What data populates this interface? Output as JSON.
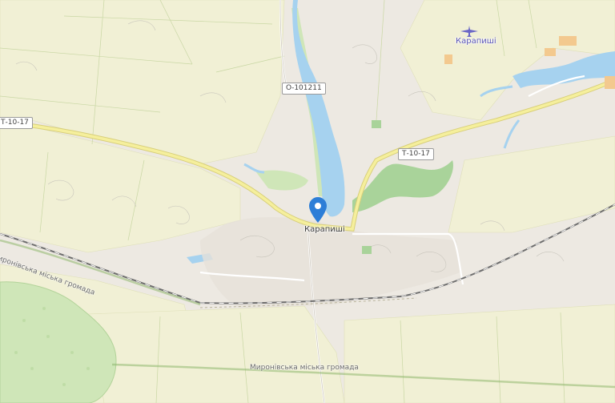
{
  "map": {
    "colors": {
      "background": "#ede9e2",
      "farmland": "#f1f0d5",
      "forest": "#cfe6b8",
      "wood_dark": "#a9d39a",
      "water": "#a6d2ef",
      "road_major": "#f5ef9c",
      "road_casing": "#d8cf7a",
      "railway": "#6d6d6d",
      "marker": "#2d7ed7"
    },
    "road_shields": {
      "t1017_west": "Т-10-17",
      "t1017_east": "Т-10-17",
      "o101211": "О-101211"
    },
    "places": {
      "village_center": "Карапиші",
      "village_ne": "Карапиші"
    },
    "boundaries": {
      "west": "Миронівська міська громада",
      "south": "Миронівська міська громада"
    },
    "icons": {
      "location_marker": "map-pin-icon",
      "airfield": "airplane-icon"
    }
  }
}
